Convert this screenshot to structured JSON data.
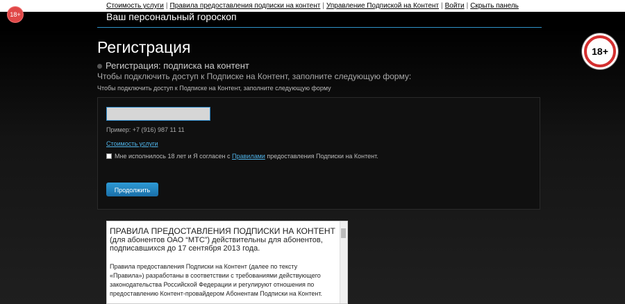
{
  "topbar": {
    "links": [
      "Стоимость услуги",
      "Правила предоставления подписки на контент",
      "Управление Подпиской на Контент",
      "Войти",
      "Скрыть панель"
    ],
    "separator": "|"
  },
  "badges": {
    "small": "18+",
    "large": "18+"
  },
  "header": {
    "title": "Ваш персональный гороскоп"
  },
  "page": {
    "title": "Регистрация",
    "subtitle": "Регистрация: подписка на контент",
    "description": "Чтобы подключить доступ к Подписке на Контент, заполните следующую форму:",
    "description_small": "Чтобы подключить доступ к Подписке на Контент, заполните следующую форму"
  },
  "form": {
    "phone_value": "",
    "example": "Пример: +7 (916) 987 11 11",
    "cost_link": "Стоимость услуги",
    "agree_before": "Мне исполнилось 18 лет и Я согласен с",
    "agree_link": "Правилами",
    "agree_after": "предоставления Подписки на Контент.",
    "continue": "Продолжить"
  },
  "rules": {
    "title": "ПРАВИЛА ПРЕДОСТАВЛЕНИЯ ПОДПИСКИ НА КОНТЕНТ",
    "sub1": "(для абонентов ОАО “МТС”) действительны для абонентов,",
    "sub2": "подписавшихся до 17 сентября 2013 года.",
    "body1": "Правила предоставления Подписки на Контент (далее по тексту",
    "body2": "«Правила») разработаны в соответствии с требованиями действующего",
    "body3": "законодательства Российской Федерации и регулируют отношения по",
    "body4": "предоставлению Контент-провайдером Абонентам Подписки на Контент."
  }
}
